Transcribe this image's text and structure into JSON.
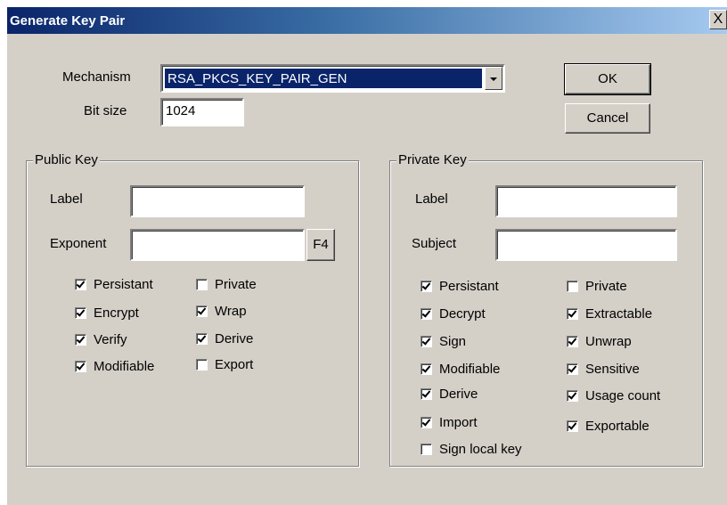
{
  "window": {
    "title": "Generate Key Pair",
    "close_label": "X"
  },
  "top": {
    "mechanism_label": "Mechanism",
    "mechanism_value": "RSA_PKCS_KEY_PAIR_GEN",
    "bitsize_label": "Bit size",
    "bitsize_value": "1024",
    "ok_label": "OK",
    "cancel_label": "Cancel"
  },
  "public_key": {
    "title": "Public Key",
    "label_label": "Label",
    "label_value": "",
    "exponent_label": "Exponent",
    "exponent_value": "",
    "f4_label": "F4",
    "checkboxes": [
      {
        "label": "Persistant",
        "checked": true
      },
      {
        "label": "Encrypt",
        "checked": true
      },
      {
        "label": "Verify",
        "checked": true
      },
      {
        "label": "Modifiable",
        "checked": true
      },
      {
        "label": "Private",
        "checked": false
      },
      {
        "label": "Wrap",
        "checked": true
      },
      {
        "label": "Derive",
        "checked": true
      },
      {
        "label": "Export",
        "checked": false
      }
    ]
  },
  "private_key": {
    "title": "Private Key",
    "label_label": "Label",
    "label_value": "",
    "subject_label": "Subject",
    "subject_value": "",
    "checkboxes": [
      {
        "label": "Persistant",
        "checked": true
      },
      {
        "label": "Decrypt",
        "checked": true
      },
      {
        "label": "Sign",
        "checked": true
      },
      {
        "label": "Modifiable",
        "checked": true
      },
      {
        "label": "Derive",
        "checked": true
      },
      {
        "label": "Import",
        "checked": true
      },
      {
        "label": "Sign local key",
        "checked": false
      },
      {
        "label": "Private",
        "checked": false
      },
      {
        "label": "Extractable",
        "checked": true
      },
      {
        "label": "Unwrap",
        "checked": true
      },
      {
        "label": "Sensitive",
        "checked": true
      },
      {
        "label": "Usage count",
        "checked": true
      },
      {
        "label": "Exportable",
        "checked": true
      }
    ]
  }
}
